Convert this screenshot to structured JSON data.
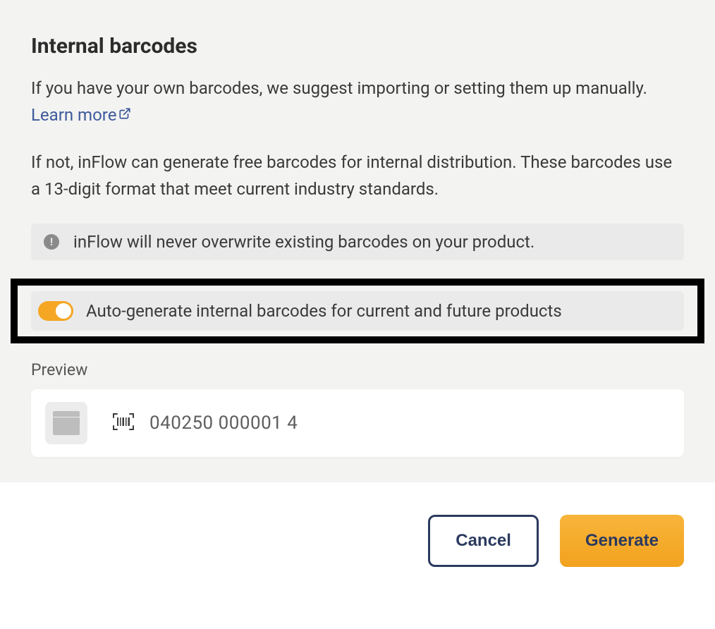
{
  "heading": "Internal barcodes",
  "paragraph1_part1": "If you have your own barcodes, we suggest importing or setting them up manually. ",
  "learn_more": "Learn more",
  "paragraph2": "If not, inFlow can generate free barcodes for internal distribution. These barcodes use a 13-digit format that meet current industry standards.",
  "info_text": "inFlow will never overwrite existing barcodes on your product.",
  "toggle_label": "Auto-generate internal barcodes for current and future products",
  "preview_label": "Preview",
  "barcode_value": "040250 000001 4",
  "buttons": {
    "cancel": "Cancel",
    "generate": "Generate"
  }
}
